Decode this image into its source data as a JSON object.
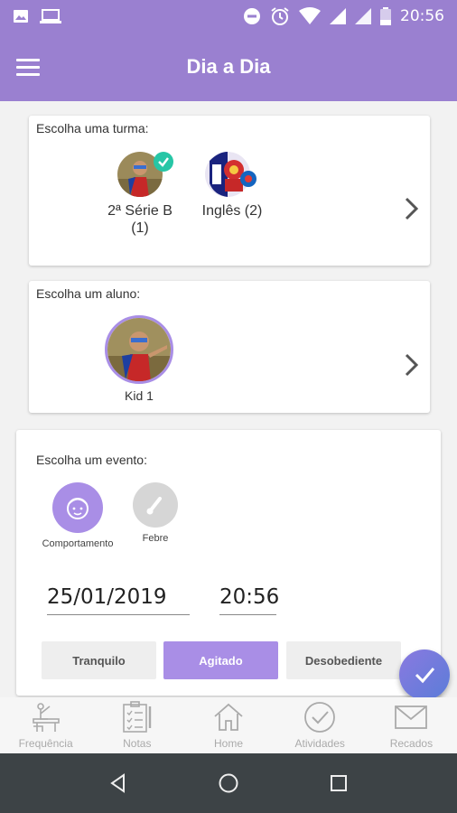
{
  "status_bar": {
    "time": "20:56"
  },
  "app_bar": {
    "title": "Dia a Dia"
  },
  "class_card": {
    "label": "Escolha uma turma:",
    "items": [
      {
        "name": "2ª Série B\n(1)",
        "line1": "2ª Série B",
        "line2": "(1)",
        "selected": true
      },
      {
        "name": "Inglês (2)",
        "line1": "Inglês (2)",
        "line2": "",
        "selected": false
      }
    ]
  },
  "student_card": {
    "label": "Escolha um aluno:",
    "students": [
      {
        "name": "Kid 1"
      }
    ]
  },
  "event_card": {
    "label": "Escolha um evento:",
    "events": [
      {
        "label": "Comportamento",
        "icon": "face-icon",
        "selected": true
      },
      {
        "label": "Febre",
        "icon": "thermometer-icon",
        "selected": false
      }
    ],
    "date": "25/01/2019",
    "time": "20:56",
    "options": [
      {
        "label": "Tranquilo",
        "selected": false
      },
      {
        "label": "Agitado",
        "selected": true
      },
      {
        "label": "Desobediente",
        "selected": false
      }
    ]
  },
  "bottom_nav": {
    "items": [
      {
        "label": "Frequência",
        "icon": "desk-icon"
      },
      {
        "label": "Notas",
        "icon": "notes-icon"
      },
      {
        "label": "Home",
        "icon": "home-icon"
      },
      {
        "label": "Atividades",
        "icon": "check-circle-icon"
      },
      {
        "label": "Recados",
        "icon": "mail-icon"
      }
    ]
  },
  "colors": {
    "primary": "#9a80d0",
    "accent_selected": "#a98ee6",
    "check_badge": "#26c6a6"
  }
}
